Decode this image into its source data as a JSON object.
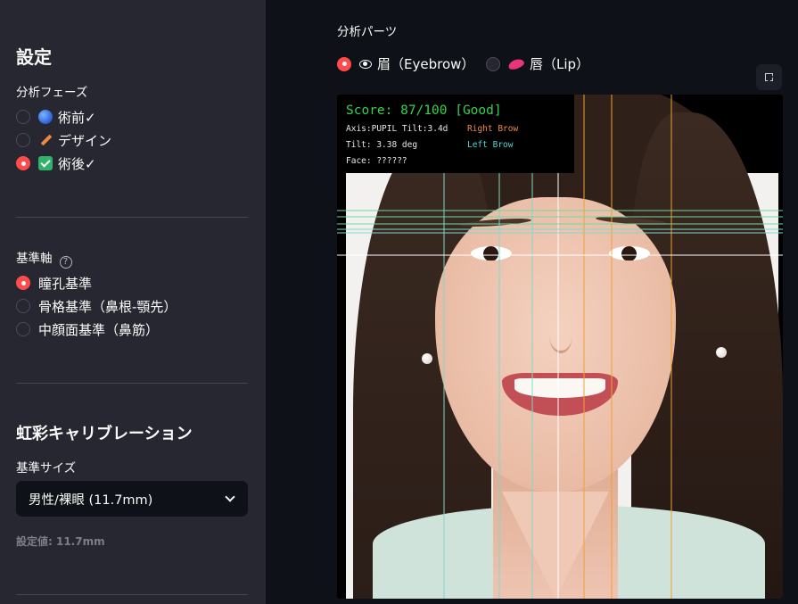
{
  "sidebar": {
    "title": "設定",
    "phase": {
      "label": "分析フェーズ",
      "options": [
        {
          "label": "術前✓",
          "icon": "globe-icon",
          "selected": false
        },
        {
          "label": "デザイン",
          "icon": "pencil-icon",
          "selected": false
        },
        {
          "label": "術後✓",
          "icon": "check-box-icon",
          "selected": true
        }
      ]
    },
    "axis": {
      "label": "基準軸",
      "help_icon": "?",
      "options": [
        {
          "label": "瞳孔基準",
          "selected": true
        },
        {
          "label": "骨格基準（鼻根-顎先）",
          "selected": false
        },
        {
          "label": "中顔面基準（鼻筋）",
          "selected": false
        }
      ]
    },
    "iris": {
      "heading": "虹彩キャリブレーション",
      "size_label": "基準サイズ",
      "selected_value": "男性/裸眼 (11.7mm)",
      "caption": "設定値: 11.7mm"
    }
  },
  "main": {
    "parts_label": "分析パーツ",
    "parts_options": [
      {
        "label": "眉（Eyebrow）",
        "icon": "eye-icon",
        "selected": true
      },
      {
        "label": "唇（Lip）",
        "icon": "lips-icon",
        "selected": false
      }
    ],
    "fullscreen_icon": "fullscreen-icon"
  },
  "overlay": {
    "score": "Score: 87/100 [Good]",
    "axis_text": "Axis:PUPIL Tilt:3.4d",
    "tilt_text": "Tilt: 3.38 deg",
    "face_text": "Face: ??????",
    "right_brow": "Right Brow",
    "left_brow": "Left Brow"
  },
  "colors": {
    "accent": "#ff4b4b",
    "score_green": "#35d24e",
    "right_brow": "#f08a4a",
    "left_brow": "#4fd8d0"
  }
}
